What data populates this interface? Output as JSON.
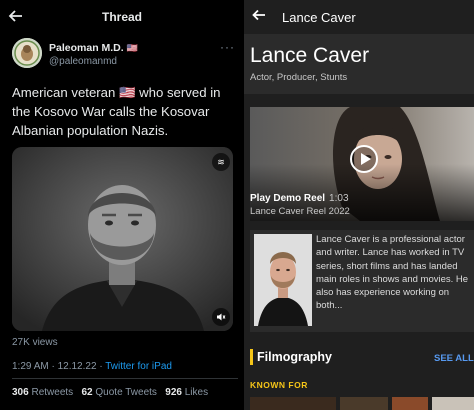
{
  "thread": {
    "back_icon": "arrow-left-icon",
    "title": "Thread",
    "author_name": "Paleoman M.D.",
    "author_flag": "🇺🇸",
    "author_handle": "@paleomanmd",
    "more_icon": "more-horizontal-icon",
    "tweet_text": "American veteran 🇺🇸 who served in the Kosovo War calls the Kosovar Albanian population Nazis.",
    "media_icons": [
      "gif-icon",
      "mute-icon"
    ],
    "views": "27K views",
    "time": "1:29 AM",
    "date": "12.12.22",
    "source": "Twitter for iPad",
    "retweets_count": "306",
    "retweets_label": "Retweets",
    "quotes_count": "62",
    "quotes_label": "Quote Tweets",
    "likes_count": "926",
    "likes_label": "Likes",
    "link_color": "#1d9bf0"
  },
  "imdb": {
    "back_icon": "arrow-left-icon",
    "header_title": "Lance Caver",
    "name": "Lance Caver",
    "roles": "Actor, Producer, Stunts",
    "reel_title": "Play Demo Reel",
    "reel_duration": "1:03",
    "reel_subtitle": "Lance Caver Reel 2022",
    "bio": "Lance Caver is a professional actor and writer. Lance has worked in TV series, short films and has landed main roles in shows and movies. He also has experience working on both...",
    "filmography_title": "Filmography",
    "see_all": "SEE ALL",
    "known_for": "KNOWN FOR",
    "accent_color": "#f5c518",
    "link_color": "#5799ef"
  }
}
